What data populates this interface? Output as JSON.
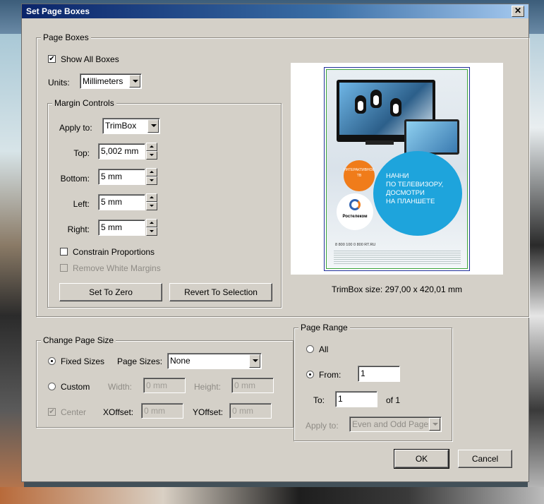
{
  "dialog": {
    "title": "Set Page Boxes",
    "close_label": "✕"
  },
  "page_boxes": {
    "legend": "Page Boxes",
    "show_all_boxes": {
      "label": "Show All Boxes",
      "checked": true
    },
    "units": {
      "label": "Units:",
      "value": "Millimeters"
    },
    "margin_controls": {
      "legend": "Margin Controls",
      "apply_to": {
        "label": "Apply to:",
        "value": "TrimBox"
      },
      "top": {
        "label": "Top:",
        "value": "5,002 mm"
      },
      "bottom": {
        "label": "Bottom:",
        "value": "5 mm"
      },
      "left": {
        "label": "Left:",
        "value": "5 mm"
      },
      "right": {
        "label": "Right:",
        "value": "5 mm"
      },
      "constrain_proportions": {
        "label": "Constrain Proportions",
        "checked": false
      },
      "remove_white_margins": {
        "label": "Remove White Margins",
        "checked": false,
        "enabled": false
      },
      "set_to_zero_label": "Set To Zero",
      "revert_label": "Revert To Selection"
    },
    "preview": {
      "badge_text": "ИНТЕРАКТИВНОЕ ТВ",
      "headline": [
        "НАЧНИ",
        "ПО ТЕЛЕВИЗОРУ,",
        "ДОСМОТРИ",
        "НА ПЛАНШЕТЕ"
      ],
      "brand": "Ростелеком",
      "phone": "8 800 100 0 800  RT.RU"
    },
    "trim_size": "TrimBox size: 297,00 x 420,01 mm"
  },
  "change_page_size": {
    "legend": "Change Page Size",
    "fixed_sizes": {
      "label": "Fixed Sizes",
      "selected": true
    },
    "page_sizes": {
      "label": "Page Sizes:",
      "value": "None"
    },
    "custom": {
      "label": "Custom",
      "selected": false
    },
    "width": {
      "label": "Width:",
      "value": "0 mm"
    },
    "height": {
      "label": "Height:",
      "value": "0 mm"
    },
    "center": {
      "label": "Center",
      "checked": true,
      "enabled": false
    },
    "xoffset": {
      "label": "XOffset:",
      "value": "0 mm"
    },
    "yoffset": {
      "label": "YOffset:",
      "value": "0 mm"
    }
  },
  "page_range": {
    "legend": "Page Range",
    "all": {
      "label": "All",
      "selected": false
    },
    "from": {
      "label": "From:",
      "value": "1",
      "selected": true
    },
    "to": {
      "label": "To:",
      "value": "1"
    },
    "of_text": "of 1",
    "apply_to": {
      "label": "Apply to:",
      "value": "Even and Odd Pages",
      "enabled": false
    }
  },
  "footer": {
    "ok_label": "OK",
    "cancel_label": "Cancel"
  },
  "colors": {
    "dialog_bg": "#d4d0c8",
    "titlebar_start": "#0a246a",
    "titlebar_end": "#a6caf0",
    "trimbox_outline": "#3aa53a",
    "mediabox_outline": "#1f2f9a"
  }
}
